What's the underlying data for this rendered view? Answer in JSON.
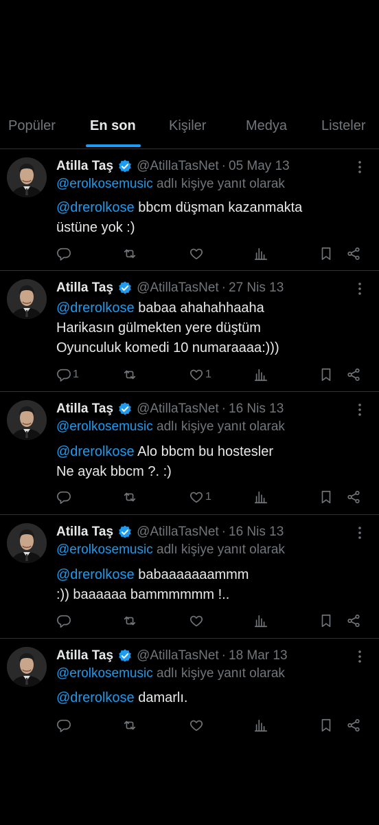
{
  "tabs": [
    {
      "label": "Popüler",
      "active": false
    },
    {
      "label": "En son",
      "active": true
    },
    {
      "label": "Kişiler",
      "active": false
    },
    {
      "label": "Medya",
      "active": false
    },
    {
      "label": "Listeler",
      "active": false
    }
  ],
  "colors": {
    "background": "#000000",
    "accent": "#1d9bf0",
    "text": "#e7e9ea",
    "muted": "#71767b",
    "divider": "#2f3336"
  },
  "tweets": [
    {
      "author": "Atilla Taş",
      "handle": "@AtillaTasNet",
      "sep": "·",
      "date": "05 May 13",
      "reply_mention": "@erolkosemusic",
      "reply_suffix": " adlı kişiye yanıt olarak",
      "mention": "@drerolkose",
      "lines": [
        " bbcm düşman kazanmakta",
        "üstüne yok :)"
      ],
      "reply_count": "",
      "like_count": ""
    },
    {
      "author": "Atilla Taş",
      "handle": "@AtillaTasNet",
      "sep": "·",
      "date": "27 Nis 13",
      "reply_mention": "",
      "reply_suffix": "",
      "mention": "@drerolkose",
      "lines": [
        " babaa ahahahhaaha",
        "Harikasın gülmekten yere düştüm",
        "Oyunculuk komedi 10 numaraaaa:)))"
      ],
      "reply_count": "1",
      "like_count": "1"
    },
    {
      "author": "Atilla Taş",
      "handle": "@AtillaTasNet",
      "sep": "·",
      "date": "16 Nis 13",
      "reply_mention": "@erolkosemusic",
      "reply_suffix": " adlı kişiye yanıt olarak",
      "mention": "@drerolkose",
      "lines": [
        " Alo bbcm bu hostesler",
        "Ne ayak bbcm ?. :)"
      ],
      "reply_count": "",
      "like_count": "1"
    },
    {
      "author": "Atilla Taş",
      "handle": "@AtillaTasNet",
      "sep": "·",
      "date": "16 Nis 13",
      "reply_mention": "@erolkosemusic",
      "reply_suffix": " adlı kişiye yanıt olarak",
      "mention": "@drerolkose",
      "lines": [
        " babaaaaaaammm",
        ":)) baaaaaa bammmmmm !.."
      ],
      "reply_count": "",
      "like_count": ""
    },
    {
      "author": "Atilla Taş",
      "handle": "@AtillaTasNet",
      "sep": "·",
      "date": "18 Mar 13",
      "reply_mention": "@erolkosemusic",
      "reply_suffix": " adlı kişiye yanıt olarak",
      "mention": "@drerolkose",
      "lines": [
        " damarlı."
      ],
      "reply_count": "",
      "like_count": ""
    }
  ]
}
